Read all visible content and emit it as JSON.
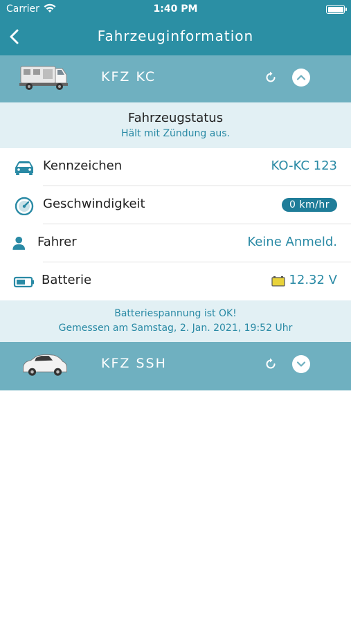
{
  "status_bar": {
    "carrier": "Carrier",
    "time": "1:40 PM"
  },
  "nav": {
    "title": "Fahrzeuginformation",
    "back_icon": "chevron-left-icon"
  },
  "vehicles": [
    {
      "name": "KFZ KC",
      "expanded": true,
      "toggle_icon": "chevron-up-icon"
    },
    {
      "name": "KFZ SSH",
      "expanded": false,
      "toggle_icon": "chevron-down-icon"
    }
  ],
  "status": {
    "title": "Fahrzeugstatus",
    "subtitle": "Hält mit Zündung aus."
  },
  "rows": [
    {
      "label": "Kennzeichen",
      "value": "KO-KC 123",
      "icon": "car-icon"
    },
    {
      "label": "Geschwindigkeit",
      "value": "0 km/hr",
      "icon": "speedometer-icon"
    },
    {
      "label": "Fahrer",
      "value": "Keine Anmeld.",
      "icon": "person-icon"
    },
    {
      "label": "Batterie",
      "value": "12.32 V",
      "icon": "battery-icon"
    }
  ],
  "battery_note": {
    "line1": "Batteriespannung ist OK!",
    "line2": "Gemessen am Samstag, 2. Jan. 2021, 19:52 Uhr"
  },
  "colors": {
    "header": "#2b8fa4",
    "vehicle_header": "#6fb0c0",
    "accent_text": "#2a8aa5",
    "badge": "#1f7d99",
    "status_bg": "#e2f0f4"
  }
}
